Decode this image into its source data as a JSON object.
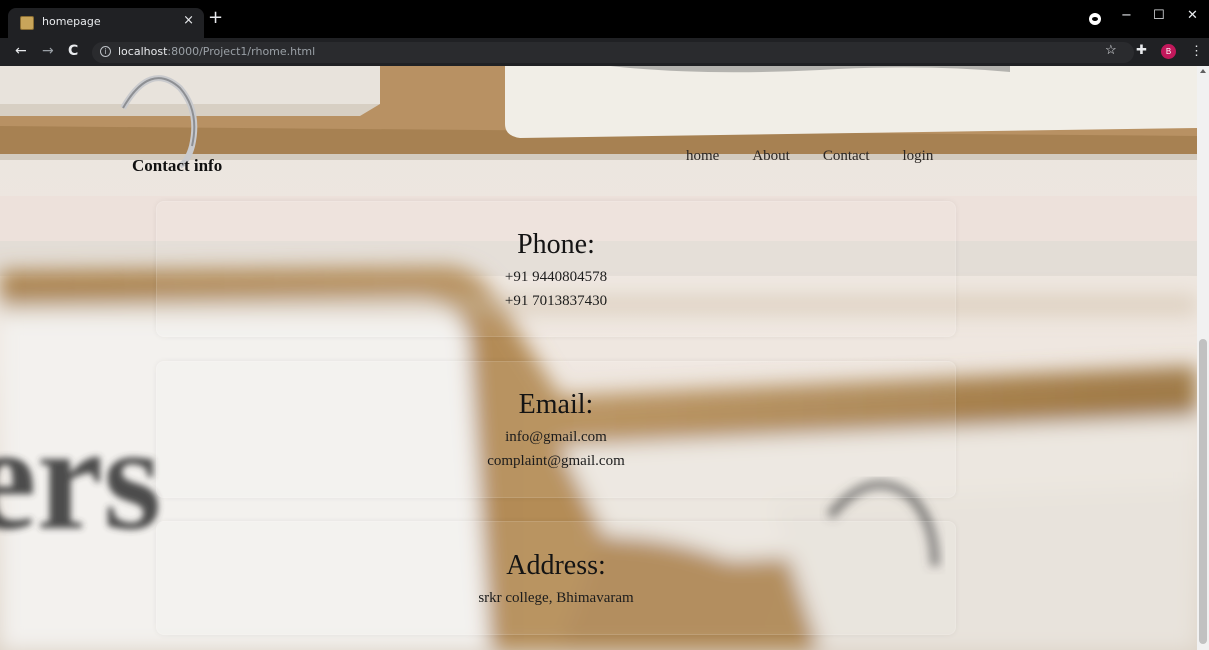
{
  "browser": {
    "tab_title": "homepage",
    "tab_close": "×",
    "new_tab": "+",
    "url_host": "localhost",
    "url_path": ":8000/Project1/rhome.html",
    "profile_initial": "B",
    "minimize": "−",
    "maximize": "☐",
    "close": "✕",
    "back": "←",
    "forward": "→",
    "reload": "C",
    "info": "i",
    "star": "☆",
    "extensions": "✚",
    "menu": "⋮"
  },
  "page": {
    "contact_heading": "Contact info",
    "nav": [
      {
        "label": "home"
      },
      {
        "label": "About"
      },
      {
        "label": "Contact"
      },
      {
        "label": "login"
      }
    ],
    "cards": [
      {
        "title": "Phone:",
        "lines": [
          "+91 9440804578",
          "+91 7013837430"
        ]
      },
      {
        "title": "Email:",
        "lines": [
          "info@gmail.com",
          "complaint@gmail.com"
        ]
      },
      {
        "title": "Address:",
        "lines": [
          "srkr college, Bhimavaram"
        ]
      }
    ],
    "background_text": "ers"
  },
  "colors": {
    "chrome_dark": "#202124",
    "tabbar": "#000000",
    "avatar": "#c2185b",
    "folder_kraft": "#b08a55"
  }
}
